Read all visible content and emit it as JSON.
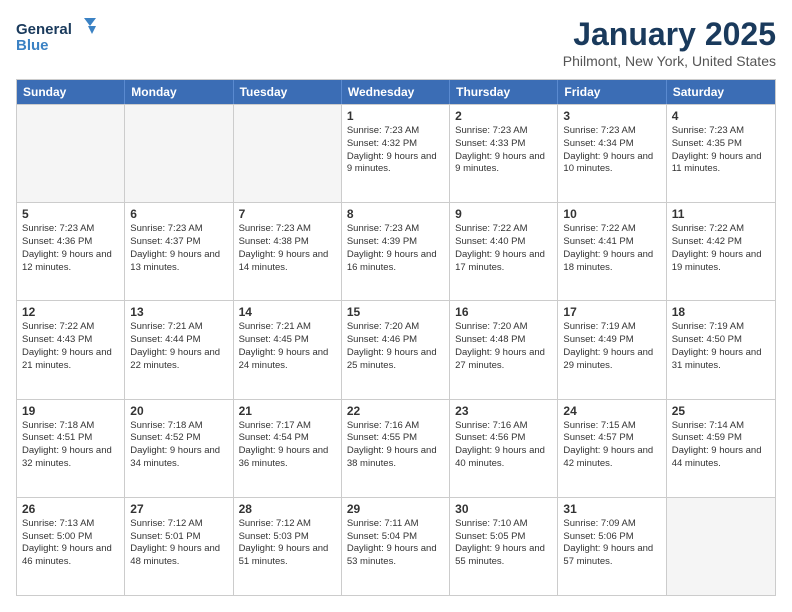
{
  "logo": {
    "line1": "General",
    "line2": "Blue"
  },
  "title": "January 2025",
  "location": "Philmont, New York, United States",
  "weekdays": [
    "Sunday",
    "Monday",
    "Tuesday",
    "Wednesday",
    "Thursday",
    "Friday",
    "Saturday"
  ],
  "rows": [
    [
      {
        "day": "",
        "text": ""
      },
      {
        "day": "",
        "text": ""
      },
      {
        "day": "",
        "text": ""
      },
      {
        "day": "1",
        "text": "Sunrise: 7:23 AM\nSunset: 4:32 PM\nDaylight: 9 hours\nand 9 minutes."
      },
      {
        "day": "2",
        "text": "Sunrise: 7:23 AM\nSunset: 4:33 PM\nDaylight: 9 hours\nand 9 minutes."
      },
      {
        "day": "3",
        "text": "Sunrise: 7:23 AM\nSunset: 4:34 PM\nDaylight: 9 hours\nand 10 minutes."
      },
      {
        "day": "4",
        "text": "Sunrise: 7:23 AM\nSunset: 4:35 PM\nDaylight: 9 hours\nand 11 minutes."
      }
    ],
    [
      {
        "day": "5",
        "text": "Sunrise: 7:23 AM\nSunset: 4:36 PM\nDaylight: 9 hours\nand 12 minutes."
      },
      {
        "day": "6",
        "text": "Sunrise: 7:23 AM\nSunset: 4:37 PM\nDaylight: 9 hours\nand 13 minutes."
      },
      {
        "day": "7",
        "text": "Sunrise: 7:23 AM\nSunset: 4:38 PM\nDaylight: 9 hours\nand 14 minutes."
      },
      {
        "day": "8",
        "text": "Sunrise: 7:23 AM\nSunset: 4:39 PM\nDaylight: 9 hours\nand 16 minutes."
      },
      {
        "day": "9",
        "text": "Sunrise: 7:22 AM\nSunset: 4:40 PM\nDaylight: 9 hours\nand 17 minutes."
      },
      {
        "day": "10",
        "text": "Sunrise: 7:22 AM\nSunset: 4:41 PM\nDaylight: 9 hours\nand 18 minutes."
      },
      {
        "day": "11",
        "text": "Sunrise: 7:22 AM\nSunset: 4:42 PM\nDaylight: 9 hours\nand 19 minutes."
      }
    ],
    [
      {
        "day": "12",
        "text": "Sunrise: 7:22 AM\nSunset: 4:43 PM\nDaylight: 9 hours\nand 21 minutes."
      },
      {
        "day": "13",
        "text": "Sunrise: 7:21 AM\nSunset: 4:44 PM\nDaylight: 9 hours\nand 22 minutes."
      },
      {
        "day": "14",
        "text": "Sunrise: 7:21 AM\nSunset: 4:45 PM\nDaylight: 9 hours\nand 24 minutes."
      },
      {
        "day": "15",
        "text": "Sunrise: 7:20 AM\nSunset: 4:46 PM\nDaylight: 9 hours\nand 25 minutes."
      },
      {
        "day": "16",
        "text": "Sunrise: 7:20 AM\nSunset: 4:48 PM\nDaylight: 9 hours\nand 27 minutes."
      },
      {
        "day": "17",
        "text": "Sunrise: 7:19 AM\nSunset: 4:49 PM\nDaylight: 9 hours\nand 29 minutes."
      },
      {
        "day": "18",
        "text": "Sunrise: 7:19 AM\nSunset: 4:50 PM\nDaylight: 9 hours\nand 31 minutes."
      }
    ],
    [
      {
        "day": "19",
        "text": "Sunrise: 7:18 AM\nSunset: 4:51 PM\nDaylight: 9 hours\nand 32 minutes."
      },
      {
        "day": "20",
        "text": "Sunrise: 7:18 AM\nSunset: 4:52 PM\nDaylight: 9 hours\nand 34 minutes."
      },
      {
        "day": "21",
        "text": "Sunrise: 7:17 AM\nSunset: 4:54 PM\nDaylight: 9 hours\nand 36 minutes."
      },
      {
        "day": "22",
        "text": "Sunrise: 7:16 AM\nSunset: 4:55 PM\nDaylight: 9 hours\nand 38 minutes."
      },
      {
        "day": "23",
        "text": "Sunrise: 7:16 AM\nSunset: 4:56 PM\nDaylight: 9 hours\nand 40 minutes."
      },
      {
        "day": "24",
        "text": "Sunrise: 7:15 AM\nSunset: 4:57 PM\nDaylight: 9 hours\nand 42 minutes."
      },
      {
        "day": "25",
        "text": "Sunrise: 7:14 AM\nSunset: 4:59 PM\nDaylight: 9 hours\nand 44 minutes."
      }
    ],
    [
      {
        "day": "26",
        "text": "Sunrise: 7:13 AM\nSunset: 5:00 PM\nDaylight: 9 hours\nand 46 minutes."
      },
      {
        "day": "27",
        "text": "Sunrise: 7:12 AM\nSunset: 5:01 PM\nDaylight: 9 hours\nand 48 minutes."
      },
      {
        "day": "28",
        "text": "Sunrise: 7:12 AM\nSunset: 5:03 PM\nDaylight: 9 hours\nand 51 minutes."
      },
      {
        "day": "29",
        "text": "Sunrise: 7:11 AM\nSunset: 5:04 PM\nDaylight: 9 hours\nand 53 minutes."
      },
      {
        "day": "30",
        "text": "Sunrise: 7:10 AM\nSunset: 5:05 PM\nDaylight: 9 hours\nand 55 minutes."
      },
      {
        "day": "31",
        "text": "Sunrise: 7:09 AM\nSunset: 5:06 PM\nDaylight: 9 hours\nand 57 minutes."
      },
      {
        "day": "",
        "text": ""
      }
    ]
  ]
}
